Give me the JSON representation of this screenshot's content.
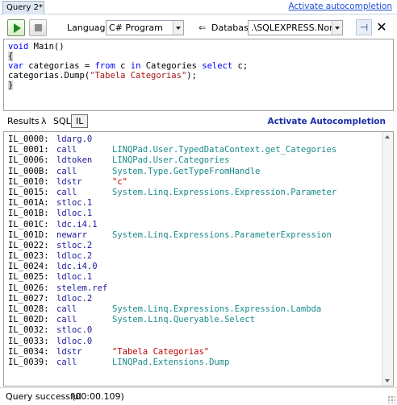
{
  "tab": {
    "label": "Query 2*"
  },
  "top_link": "Activate autocompletion",
  "toolbar": {
    "language_label": "Language",
    "language_value": "C# Program",
    "database_label": "Database",
    "database_value": ".\\SQLEXPRESS.Northwi",
    "pin_glyph": "⊣",
    "close_glyph": "✕",
    "db_arrow_glyph": "⇐"
  },
  "editor": {
    "lines": [
      {
        "parts": [
          {
            "t": "void",
            "c": "kw"
          },
          {
            "t": " Main()",
            "c": ""
          }
        ]
      },
      {
        "parts": [
          {
            "t": "{",
            "c": "brace"
          }
        ]
      },
      {
        "parts": [
          {
            "t": "var",
            "c": "kw"
          },
          {
            "t": " categorias = ",
            "c": ""
          },
          {
            "t": "from",
            "c": "kw"
          },
          {
            "t": " c ",
            "c": ""
          },
          {
            "t": "in",
            "c": "kw"
          },
          {
            "t": " Categories ",
            "c": ""
          },
          {
            "t": "select",
            "c": "kw"
          },
          {
            "t": " c;",
            "c": ""
          }
        ]
      },
      {
        "parts": [
          {
            "t": "categorias.Dump(",
            "c": ""
          },
          {
            "t": "\"Tabela Categorias\"",
            "c": "str"
          },
          {
            "t": ");",
            "c": ""
          }
        ]
      },
      {
        "parts": [
          {
            "t": "}",
            "c": "brace"
          }
        ]
      }
    ]
  },
  "results_tabs": {
    "results": "Results",
    "lambda": "λ",
    "sql": "SQL",
    "il": "IL"
  },
  "activate_bold": "Activate Autocompletion",
  "il_rows": [
    {
      "offset": "IL_0000:",
      "op": "ldarg.0",
      "arg": "",
      "str": false
    },
    {
      "offset": "IL_0001:",
      "op": "call",
      "arg": "LINQPad.User.TypedDataContext.get_Categories",
      "str": false
    },
    {
      "offset": "IL_0006:",
      "op": "ldtoken",
      "arg": "LINQPad.User.Categories",
      "str": false
    },
    {
      "offset": "IL_000B:",
      "op": "call",
      "arg": "System.Type.GetTypeFromHandle",
      "str": false
    },
    {
      "offset": "IL_0010:",
      "op": "ldstr",
      "arg": "\"c\"",
      "str": true
    },
    {
      "offset": "IL_0015:",
      "op": "call",
      "arg": "System.Linq.Expressions.Expression.Parameter",
      "str": false
    },
    {
      "offset": "IL_001A:",
      "op": "stloc.1",
      "arg": "",
      "str": false
    },
    {
      "offset": "IL_001B:",
      "op": "ldloc.1",
      "arg": "",
      "str": false
    },
    {
      "offset": "IL_001C:",
      "op": "ldc.i4.1",
      "arg": "",
      "str": false
    },
    {
      "offset": "IL_001D:",
      "op": "newarr",
      "arg": "System.Linq.Expressions.ParameterExpression",
      "str": false
    },
    {
      "offset": "IL_0022:",
      "op": "stloc.2",
      "arg": "",
      "str": false
    },
    {
      "offset": "IL_0023:",
      "op": "ldloc.2",
      "arg": "",
      "str": false
    },
    {
      "offset": "IL_0024:",
      "op": "ldc.i4.0",
      "arg": "",
      "str": false
    },
    {
      "offset": "IL_0025:",
      "op": "ldloc.1",
      "arg": "",
      "str": false
    },
    {
      "offset": "IL_0026:",
      "op": "stelem.ref",
      "arg": "",
      "str": false
    },
    {
      "offset": "IL_0027:",
      "op": "ldloc.2",
      "arg": "",
      "str": false
    },
    {
      "offset": "IL_0028:",
      "op": "call",
      "arg": "System.Linq.Expressions.Expression.Lambda",
      "str": false
    },
    {
      "offset": "IL_002D:",
      "op": "call",
      "arg": "System.Linq.Queryable.Select",
      "str": false
    },
    {
      "offset": "IL_0032:",
      "op": "stloc.0",
      "arg": "",
      "str": false
    },
    {
      "offset": "IL_0033:",
      "op": "ldloc.0",
      "arg": "",
      "str": false
    },
    {
      "offset": "IL_0034:",
      "op": "ldstr",
      "arg": "\"Tabela Categorias\"",
      "str": true
    },
    {
      "offset": "IL_0039:",
      "op": "call",
      "arg": "LINQPad.Extensions.Dump",
      "str": false
    }
  ],
  "status": {
    "message": "Query successful",
    "elapsed": "(00:00.109)"
  },
  "colors": {
    "link": "#1f4fd8",
    "keyword": "#0000ff",
    "string": "#a31515",
    "il_operand": "#1a8a8a",
    "il_string": "#c00000",
    "il_opcode": "#1a1a9a"
  }
}
